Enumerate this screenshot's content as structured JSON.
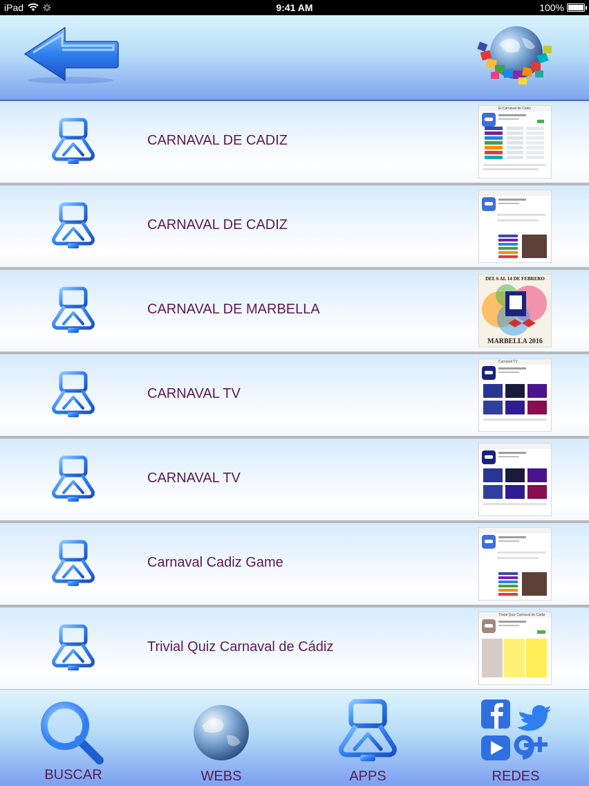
{
  "status_bar": {
    "device": "iPad",
    "time": "9:41 AM",
    "battery": "100%",
    "battery_level": 1.0
  },
  "header": {
    "back_icon": "back-arrow-icon",
    "logo_icon": "globe-puzzle-icon"
  },
  "list": {
    "items": [
      {
        "label": "CARNAVAL DE CADIZ",
        "thumb_title": "El Carnaval de Cádiz",
        "thumb_kind": "store-grid"
      },
      {
        "label": "CARNAVAL DE CADIZ",
        "thumb_title": "",
        "thumb_kind": "store-page"
      },
      {
        "label": "CARNAVAL DE MARBELLA",
        "thumb_title": "DEL 6 AL 14 DE FEBRERO",
        "thumb_footer": "MARBELLA 2016",
        "thumb_kind": "poster"
      },
      {
        "label": "CARNAVAL TV",
        "thumb_title": "Carnaval TV",
        "thumb_kind": "store-dark"
      },
      {
        "label": "CARNAVAL TV",
        "thumb_title": "",
        "thumb_kind": "store-page-dark"
      },
      {
        "label": "Carnaval Cadiz Game",
        "thumb_title": "",
        "thumb_kind": "store-page"
      },
      {
        "label": "Trivial Quiz Carnaval de Cádiz",
        "thumb_title": "Trivial Quiz Carnaval de Cádiz",
        "thumb_kind": "store-yellow"
      }
    ]
  },
  "tabbar": {
    "tabs": [
      {
        "label": "BUSCAR",
        "icon": "magnifier-icon"
      },
      {
        "label": "WEBS",
        "icon": "globe-icon"
      },
      {
        "label": "APPS",
        "icon": "app-device-icon"
      },
      {
        "label": "REDES",
        "icon": "social-networks-icon"
      }
    ]
  },
  "colors": {
    "label_text": "#5a1a52",
    "icon_blue": "#2f7ff0",
    "header_bottom": "#4a63d6"
  }
}
